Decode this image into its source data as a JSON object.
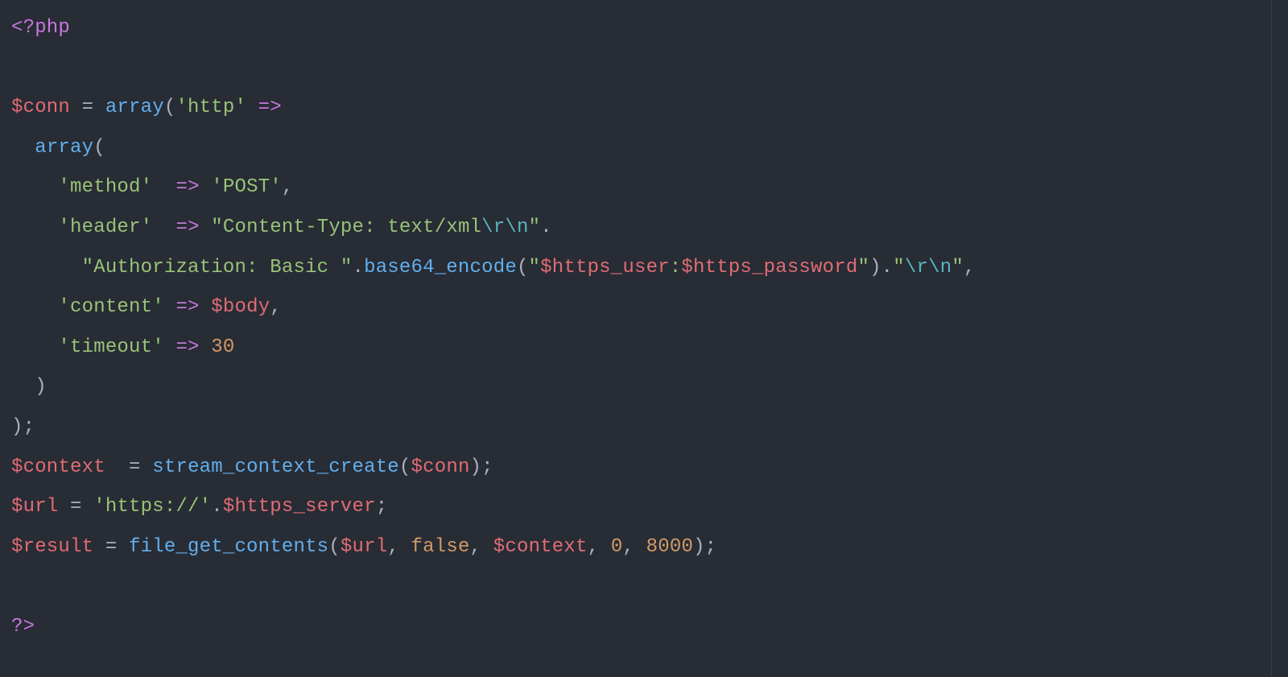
{
  "code": {
    "open_tag": "<?php",
    "close_tag": "?>",
    "var_conn": "$conn",
    "var_body": "$body",
    "var_context": "$context",
    "var_url": "$url",
    "var_result": "$result",
    "var_https_user": "$https_user",
    "var_https_password": "$https_password",
    "var_https_server": "$https_server",
    "fn_array": "array",
    "fn_b64": "base64_encode",
    "fn_scc": "stream_context_create",
    "fn_fgc": "file_get_contents",
    "kw_false": "false",
    "str_http": "'http'",
    "str_method": "'method'",
    "str_post": "'POST'",
    "str_header": "'header'",
    "str_ct_open": "\"Content-Type: text/xml",
    "esc_r": "\\r",
    "esc_n": "\\n",
    "str_auth_open": "\"Authorization: Basic \"",
    "str_b64_arg_open": "\"",
    "str_colon": ":",
    "str_b64_arg_close": "\"",
    "str_trail_open": "\"",
    "str_trail_close": "\"",
    "str_content": "'content'",
    "str_timeout": "'timeout'",
    "num_30": "30",
    "num_0": "0",
    "num_8000": "8000",
    "str_https_scheme": "'https://'",
    "op_eq": " = ",
    "op_arrow2": "  => ",
    "op_arrow": " => ",
    "op_cat": ".",
    "p_open": "(",
    "p_close": ")",
    "p_semi": ";",
    "p_comma": ",",
    "p_comma_sp": ", "
  }
}
